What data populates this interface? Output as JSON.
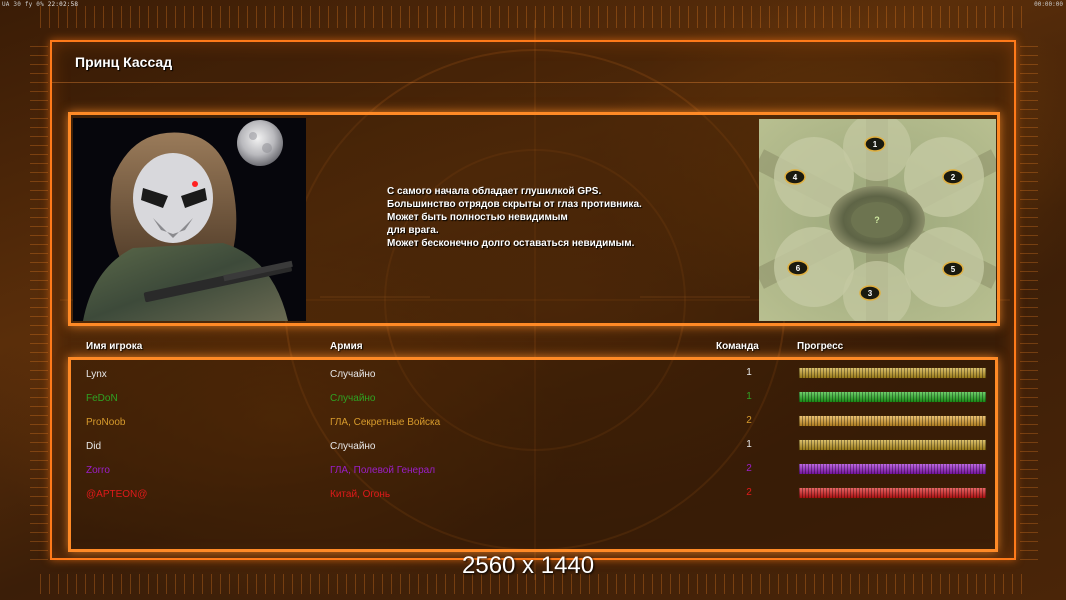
{
  "system": {
    "left_stats": "UA 30 fy 0%",
    "clock": "22:02:58",
    "right_clock": "00:00:00"
  },
  "faction": {
    "title": "Принц Кассад",
    "description": [
      "С самого начала обладает глушилкой GPS.",
      "Большинство отрядов скрыты от глаз противника.",
      "Может быть полностью невидимым",
      "для врага.",
      "Может бесконечно долго оставаться невидимым."
    ]
  },
  "minimap": {
    "markers": [
      "1",
      "2",
      "3",
      "4",
      "5",
      "6"
    ],
    "center_marker": "?"
  },
  "table": {
    "headers": {
      "name": "Имя игрока",
      "army": "Армия",
      "team": "Команда",
      "progress": "Прогресс"
    },
    "players": [
      {
        "name": "Lynx",
        "army": "Случайно",
        "team": "1",
        "color": "#e8e8e8",
        "bar": "#c9a020",
        "progress": 1.0
      },
      {
        "name": "FeDoN",
        "army": "Случайно",
        "team": "1",
        "color": "#2fa323",
        "bar": "#22b51c",
        "progress": 1.0
      },
      {
        "name": "ProNoob",
        "army": "ГЛА, Секретные Войска",
        "team": "2",
        "color": "#d79b2c",
        "bar": "#e3a32a",
        "progress": 1.0
      },
      {
        "name": "Did",
        "army": "Случайно",
        "team": "1",
        "color": "#e8e8e8",
        "bar": "#c9a020",
        "progress": 1.0
      },
      {
        "name": "Zorro",
        "army": "ГЛА, Полевой Генерал",
        "team": "2",
        "color": "#9b1ec8",
        "bar": "#9a19d0",
        "progress": 1.0
      },
      {
        "name": "@APTEON@",
        "army": "Китай, Огонь",
        "team": "2",
        "color": "#e01a1a",
        "bar": "#dd1414",
        "progress": 1.0
      }
    ]
  },
  "watermark": "2560 x 1440"
}
